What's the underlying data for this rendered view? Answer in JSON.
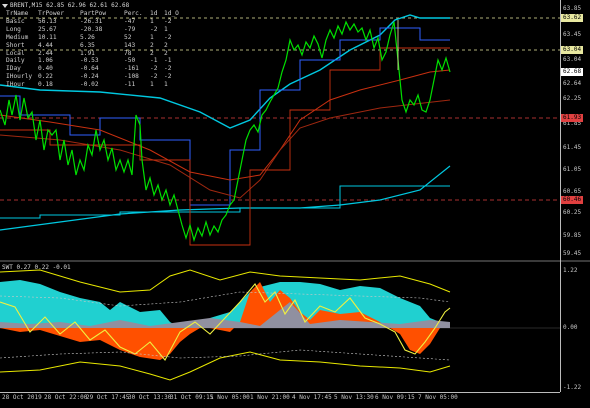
{
  "window": {
    "symbol_title": "BRENT,M15  62.85 62.96 62.61 62.68",
    "indicator_title": "SWT 0.27 0.22 -0.01"
  },
  "power_table": {
    "header": [
      "TrName",
      "TrPower",
      "PartPow",
      "Perc.",
      "1d",
      "1d_O"
    ],
    "rows": [
      [
        "Basic",
        "56.13",
        "-26.31",
        "-47",
        "1",
        "-2"
      ],
      [
        "Long",
        "25.67",
        "-20.38",
        "-79",
        "-2",
        "1"
      ],
      [
        "Medium",
        "10.11",
        "5.26",
        "52",
        "1",
        "-2"
      ],
      [
        "Short",
        "4.44",
        "6.35",
        "143",
        "2",
        "2"
      ],
      [
        "Local",
        "2.44",
        "1.91",
        "78",
        "2",
        "2"
      ],
      [
        "Daily",
        "1.06",
        "-0.53",
        "-50",
        "-1",
        "-1"
      ],
      [
        "IDay",
        "0.40",
        "-0.64",
        "-161",
        "-2",
        "-2"
      ],
      [
        "IHourly",
        "0.22",
        "-0.24",
        "-108",
        "-2",
        "-2"
      ],
      [
        "IHour",
        "0.18",
        "-0.02",
        "-11",
        "1",
        "1"
      ]
    ]
  },
  "price_axis": {
    "labels": [
      "63.85",
      "63.45",
      "63.04",
      "62.64",
      "62.25",
      "61.85",
      "61.45",
      "61.05",
      "60.65",
      "60.25",
      "59.85",
      "59.45"
    ],
    "tags": [
      {
        "text": "63.62",
        "color": "#e8e8a0"
      },
      {
        "text": "63.04",
        "color": "#e8e8a0"
      },
      {
        "text": "62.68",
        "color": "#ffffff"
      },
      {
        "text": "61.93",
        "color": "#e04040"
      },
      {
        "text": "60.46",
        "color": "#e04040"
      }
    ]
  },
  "indicator_axis": {
    "labels": [
      "1.22",
      "0.00",
      "-1.22"
    ]
  },
  "time_axis": {
    "labels": [
      "28 Oct 2019",
      "28 Oct 22:00",
      "29 Oct 17:45",
      "30 Oct 13:30",
      "31 Oct 09:15",
      "1 Nov 05:00",
      "1 Nov 21:00",
      "4 Nov 17:45",
      "5 Nov 13:30",
      "6 Nov 09:15",
      "7 Nov 05:00"
    ]
  },
  "colors": {
    "price": "#00e000",
    "cyan_line": "#00c8e0",
    "blue_step": "#3060ff",
    "red_line": "#c83010",
    "yellow_level": "#e8e8a0",
    "red_level": "#e04040",
    "area_cyan": "#20d0d0",
    "area_orange": "#ff5000",
    "yellow_band": "#e8e800"
  },
  "chart_data": {
    "type": "line",
    "price_close_sample": [
      62.2,
      62.6,
      62.4,
      62.0,
      61.1,
      61.4,
      61.8,
      61.3,
      60.9,
      61.9,
      61.0,
      60.9,
      61.5,
      60.8,
      60.6,
      60.8,
      60.0,
      59.7,
      59.8,
      60.1,
      60.6,
      61.5,
      62.1,
      62.6,
      63.0,
      63.1,
      63.3,
      63.4,
      63.1,
      63.3,
      63.7,
      63.6,
      63.2,
      63.3,
      63.8,
      62.4,
      62.2,
      62.6,
      62.9,
      62.9
    ],
    "levels": [
      63.62,
      63.04,
      61.93,
      60.46
    ],
    "current": 62.68
  }
}
